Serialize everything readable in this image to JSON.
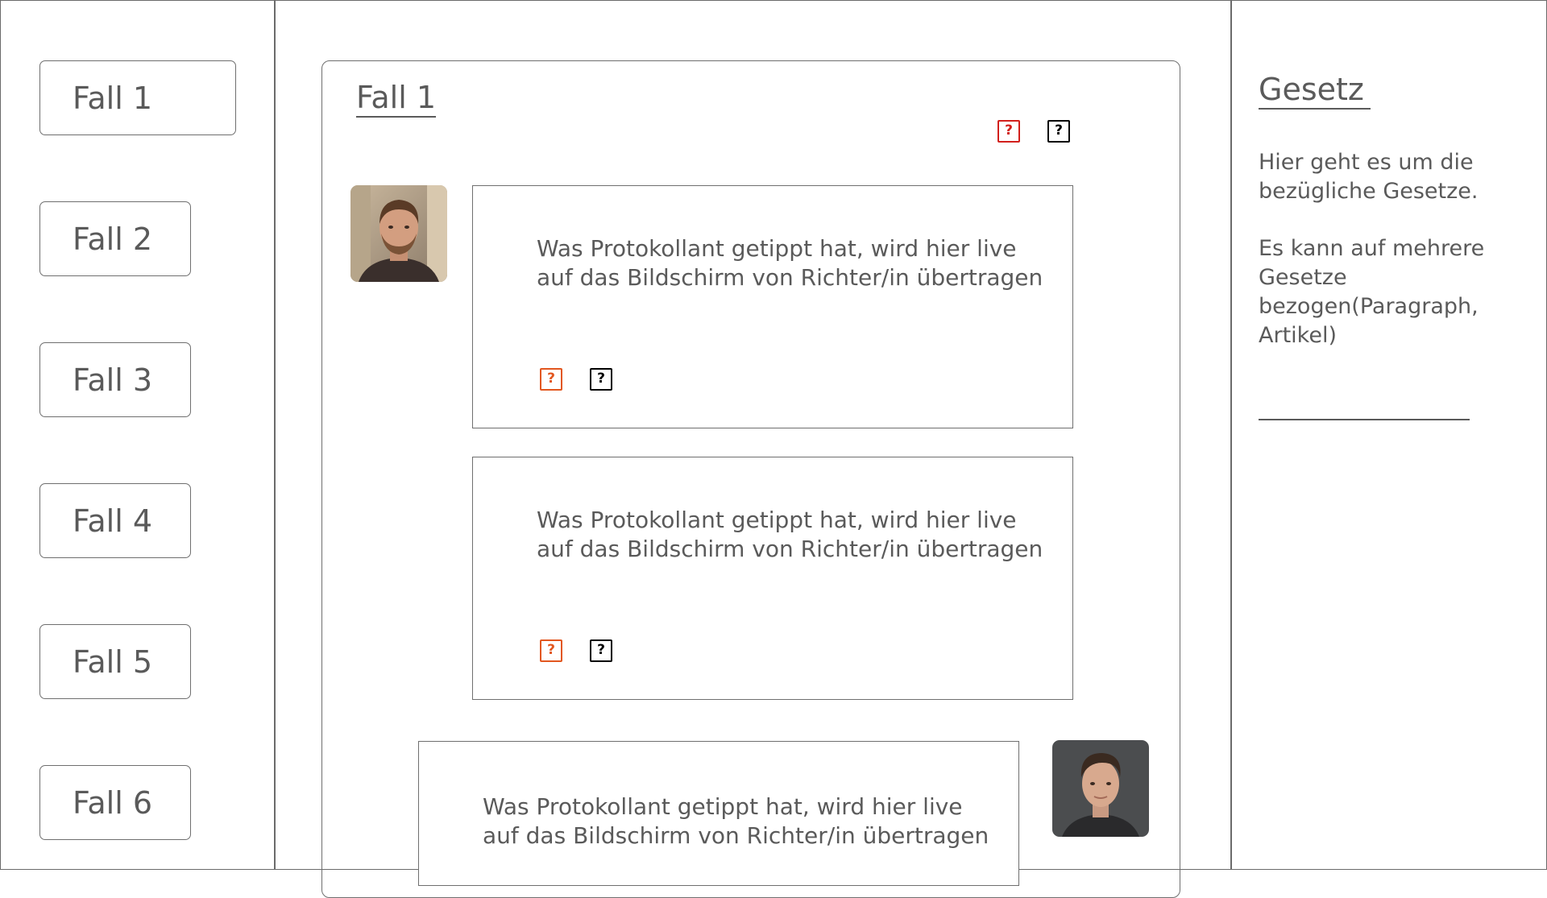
{
  "sidebar": {
    "cases": [
      {
        "label": "Fall 1"
      },
      {
        "label": "Fall 2"
      },
      {
        "label": "Fall 3"
      },
      {
        "label": "Fall 4"
      },
      {
        "label": "Fall 5"
      },
      {
        "label": "Fall 6"
      }
    ]
  },
  "main": {
    "title": "Fall 1",
    "header_icons": [
      {
        "icon": "help-icon",
        "color": "#d2201c",
        "glyph": "?"
      },
      {
        "icon": "help-icon",
        "color": "#000000",
        "glyph": "?"
      }
    ],
    "messages": [
      {
        "text": "Was Protokollant getippt hat, wird hier live\nauf das Bildschirm von Richter/in übertragen",
        "icons": [
          {
            "icon": "help-icon",
            "color": "#e2571f",
            "glyph": "?"
          },
          {
            "icon": "help-icon",
            "color": "#000000",
            "glyph": "?"
          }
        ]
      },
      {
        "text": "Was Protokollant getippt hat, wird hier live\nauf das Bildschirm von Richter/in übertragen",
        "icons": [
          {
            "icon": "help-icon",
            "color": "#e2571f",
            "glyph": "?"
          },
          {
            "icon": "help-icon",
            "color": "#000000",
            "glyph": "?"
          }
        ]
      },
      {
        "text": "Was Protokollant getippt hat, wird hier live\nauf das Bildschirm von Richter/in übertragen"
      }
    ]
  },
  "law_panel": {
    "title": "Gesetz",
    "paragraph_1": "Hier geht es um die bezügliche Gesetze.",
    "paragraph_2": "Es kann auf mehrere Gesetze bezogen(Paragraph, Artikel)"
  },
  "colors": {
    "text": "#5a5a5a",
    "border": "#6f6f6f",
    "icon_red": "#d2201c",
    "icon_orange": "#e2571f"
  }
}
